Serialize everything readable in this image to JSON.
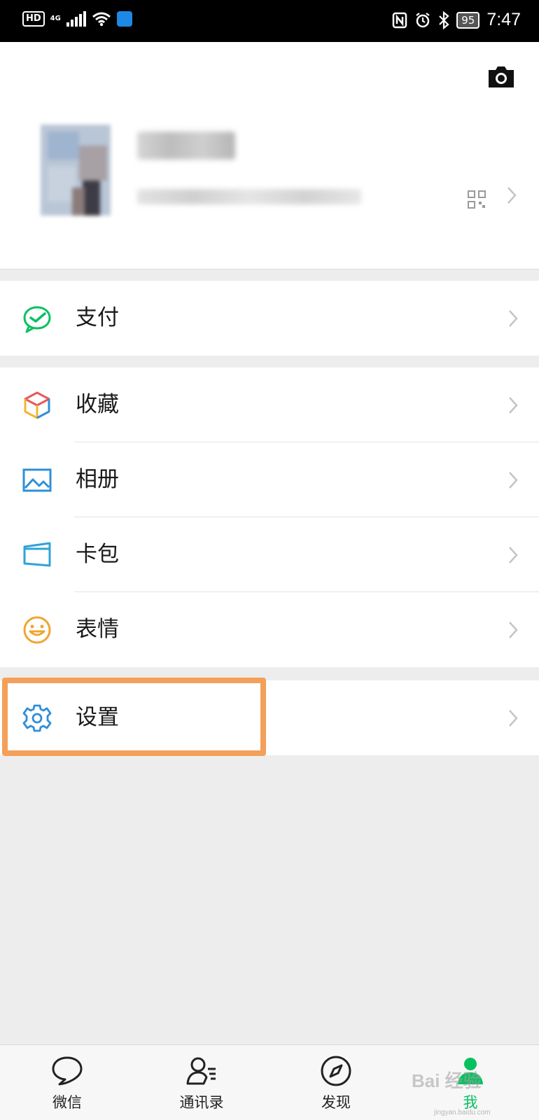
{
  "status_bar": {
    "left_badge": "HD",
    "network": "4G",
    "battery": "95",
    "time": "7:47"
  },
  "profile": {
    "camera_icon": "camera-icon",
    "qr_icon": "qr-code-icon"
  },
  "menu": {
    "pay": {
      "label": "支付",
      "icon": "wechat-pay-icon",
      "color": "#07c160"
    },
    "favorites": {
      "label": "收藏",
      "icon": "cube-icon"
    },
    "album": {
      "label": "相册",
      "icon": "picture-icon",
      "color": "#2f8fd8"
    },
    "cards": {
      "label": "卡包",
      "icon": "card-icon",
      "color": "#2fa3d8"
    },
    "stickers": {
      "label": "表情",
      "icon": "smiley-icon",
      "color": "#f0a531"
    },
    "settings": {
      "label": "设置",
      "icon": "gear-icon",
      "color": "#2f8fd8"
    }
  },
  "highlight_color": "#f4a05a",
  "tabbar": {
    "tabs": [
      {
        "label": "微信",
        "icon": "chat-bubble-icon",
        "active": false
      },
      {
        "label": "通讯录",
        "icon": "contacts-icon",
        "active": false
      },
      {
        "label": "发现",
        "icon": "compass-icon",
        "active": false
      },
      {
        "label": "我",
        "icon": "person-icon",
        "active": true
      }
    ],
    "active_color": "#07c160"
  },
  "watermark": {
    "text": "Bai 经验",
    "sub": "jingyan.baidu.com"
  }
}
